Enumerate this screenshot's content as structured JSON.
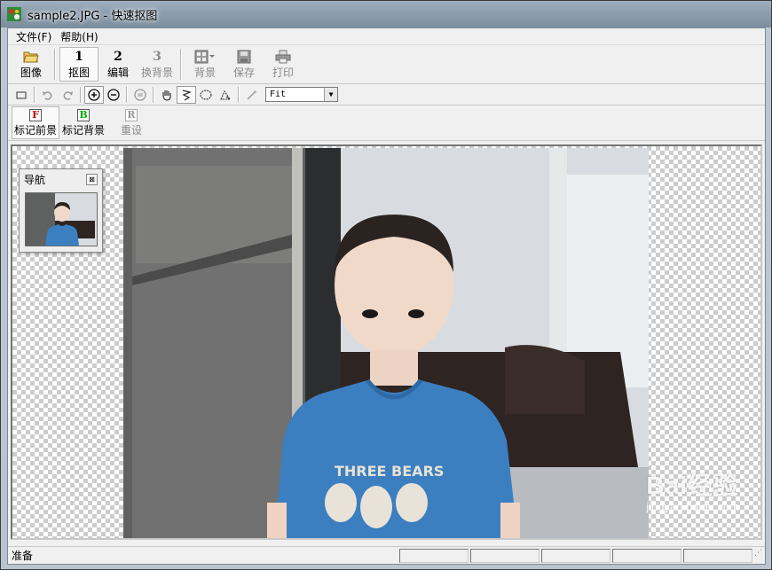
{
  "window": {
    "title": "sample2.JPG - 快速抠图",
    "icon": "app-logo-icon"
  },
  "menu": {
    "items": [
      "文件(F)",
      "帮助(H)"
    ]
  },
  "toolbar_main": {
    "image_label": "图像",
    "cutout_num": "1",
    "cutout_label": "抠图",
    "edit_num": "2",
    "edit_label": "编辑",
    "change_bg_num": "3",
    "change_bg_label": "换背景",
    "background_label": "背景",
    "save_label": "保存",
    "print_label": "打印"
  },
  "toolbar_tools": {
    "zoom_value": "Fit"
  },
  "toolbar_mark": {
    "foreground_letter": "F",
    "foreground_label": "标记前景",
    "background_letter": "B",
    "background_label": "标记背景",
    "reset_letter": "R",
    "reset_label": "重设"
  },
  "navigator": {
    "title": "导航",
    "close": "⊠"
  },
  "photo": {
    "shirt_text": "THREE BEARS"
  },
  "watermark": {
    "logo": "Bai经验",
    "sub": "jingyan.baidu.com"
  },
  "status": {
    "text": "准备"
  },
  "colors": {
    "foreground_mark": "#cc0000",
    "background_mark": "#00aa00"
  }
}
